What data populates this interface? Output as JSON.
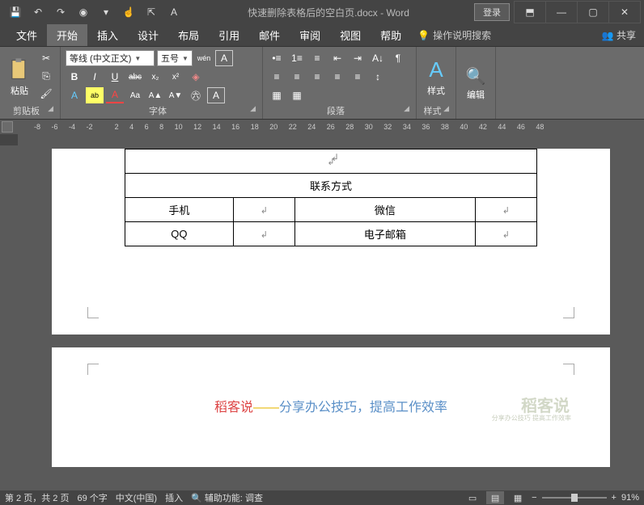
{
  "title": "快速删除表格后的空白页.docx - Word",
  "login": "登录",
  "wincontrols": {
    "ribbonmode": "⬒",
    "min": "—",
    "max": "▢",
    "close": "✕"
  },
  "qat": {
    "save": "💾",
    "undo": "↶",
    "redo": "↷",
    "rec": "◉",
    "customize": "▾",
    "touch": "☝",
    "select": "⇱",
    "font": "A"
  },
  "tabs": {
    "file": "文件",
    "home": "开始",
    "insert": "插入",
    "design": "设计",
    "layout": "布局",
    "references": "引用",
    "mailings": "邮件",
    "review": "审阅",
    "view": "视图",
    "help": "帮助",
    "tellme": "操作说明搜索",
    "share": "共享"
  },
  "ribbon": {
    "clipboard": {
      "label": "剪贴板",
      "paste": "粘贴",
      "cut": "✂",
      "copy": "⎘",
      "fmtpainter": "🖌"
    },
    "font": {
      "label": "字体",
      "name": "等线 (中文正文)",
      "size": "五号",
      "phonetic": "wén",
      "charborder": "A",
      "bold": "B",
      "italic": "I",
      "underline": "U",
      "strike": "abc",
      "sub": "x₂",
      "sup": "x²",
      "clearfmt": "◈",
      "texteffect": "A",
      "highlight": "ab",
      "fontcolor": "A",
      "changecase": "Aa",
      "grow": "A▲",
      "shrink": "A▼",
      "circled": "㊅",
      "boxA": "A"
    },
    "para": {
      "label": "段落",
      "bullets": "•≡",
      "numbers": "1≡",
      "multilevel": "≡",
      "indent_dec": "⇤",
      "indent_inc": "⇥",
      "sort": "A↓",
      "showmarks": "¶",
      "align_l": "≡",
      "align_c": "≡",
      "align_r": "≡",
      "align_j": "≡",
      "distribute": "≡",
      "linespace": "↕",
      "shading": "▦",
      "border": "▦"
    },
    "styles": {
      "label": "样式",
      "styles": "样式",
      "icon": "A"
    },
    "editing": {
      "label": "编辑",
      "find": "编辑",
      "icon": "🔍"
    }
  },
  "ruler": [
    "-8",
    "-6",
    "-4",
    "-2",
    "",
    "2",
    "4",
    "6",
    "8",
    "10",
    "12",
    "14",
    "16",
    "18",
    "20",
    "22",
    "24",
    "26",
    "28",
    "30",
    "32",
    "34",
    "36",
    "38",
    "40",
    "42",
    "44",
    "46",
    "48"
  ],
  "document": {
    "table": {
      "header": "联系方式",
      "r1": {
        "c1": "手机",
        "c3": "微信"
      },
      "r2": {
        "c1": "QQ",
        "c3": "电子邮箱"
      }
    },
    "slogan": {
      "red": "稻客说",
      "line": "——",
      "blue": "分享办公技巧，提高工作效率"
    },
    "watermark": "稻客说",
    "watermark_sub": "分享办公技巧 提高工作效率"
  },
  "status": {
    "page": "第 2 页，共 2 页",
    "words": "69 个字",
    "lang": "中文(中国)",
    "mode": "插入",
    "a11y": "辅助功能: 调查",
    "zoom": "91%"
  }
}
